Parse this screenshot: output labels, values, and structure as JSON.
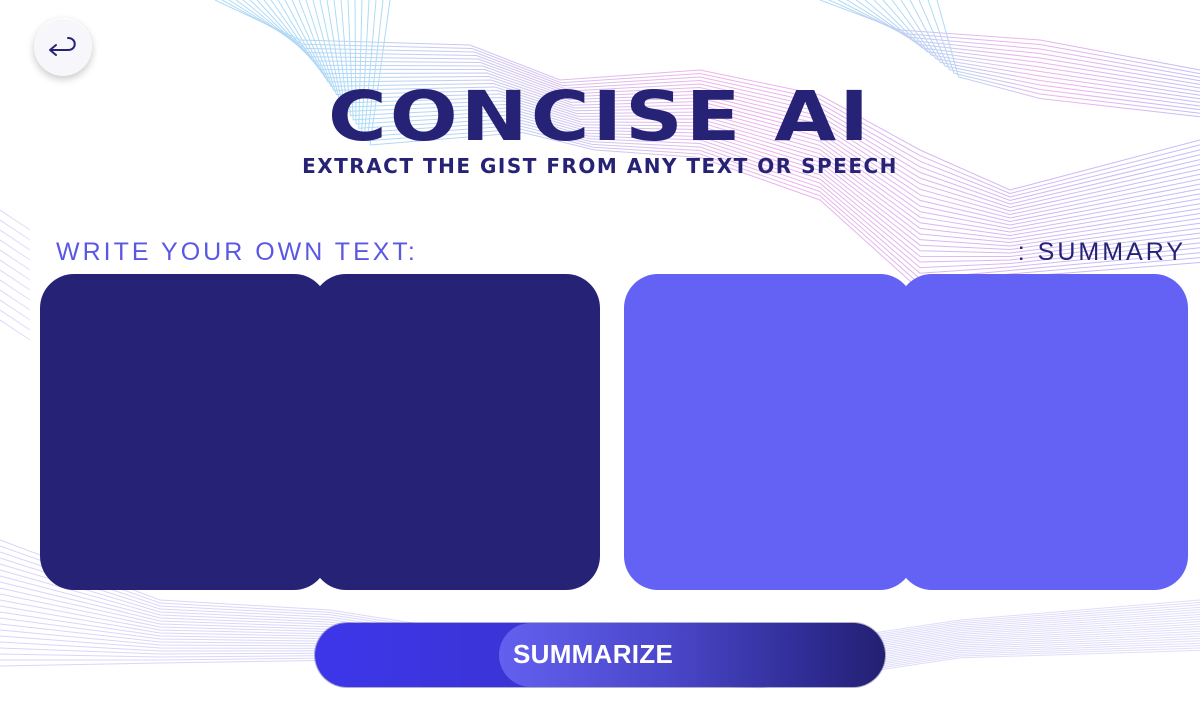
{
  "header": {
    "title": "CONCISE AI",
    "subtitle": "EXTRACT THE GIST FROM ANY TEXT OR SPEECH"
  },
  "nav": {
    "back_icon": "return-arrow-icon"
  },
  "input_section": {
    "label": "WRITE YOUR OWN TEXT:",
    "value": "",
    "placeholder": ""
  },
  "summary_section": {
    "label": ": SUMMARY",
    "value": ""
  },
  "actions": {
    "summarize_label": "SUMMARIZE"
  },
  "colors": {
    "primary_navy": "#262376",
    "accent_indigo": "#6362f5",
    "label_purple": "#5b57e6",
    "button_blue": "#3d36ea",
    "background": "#ffffff"
  }
}
